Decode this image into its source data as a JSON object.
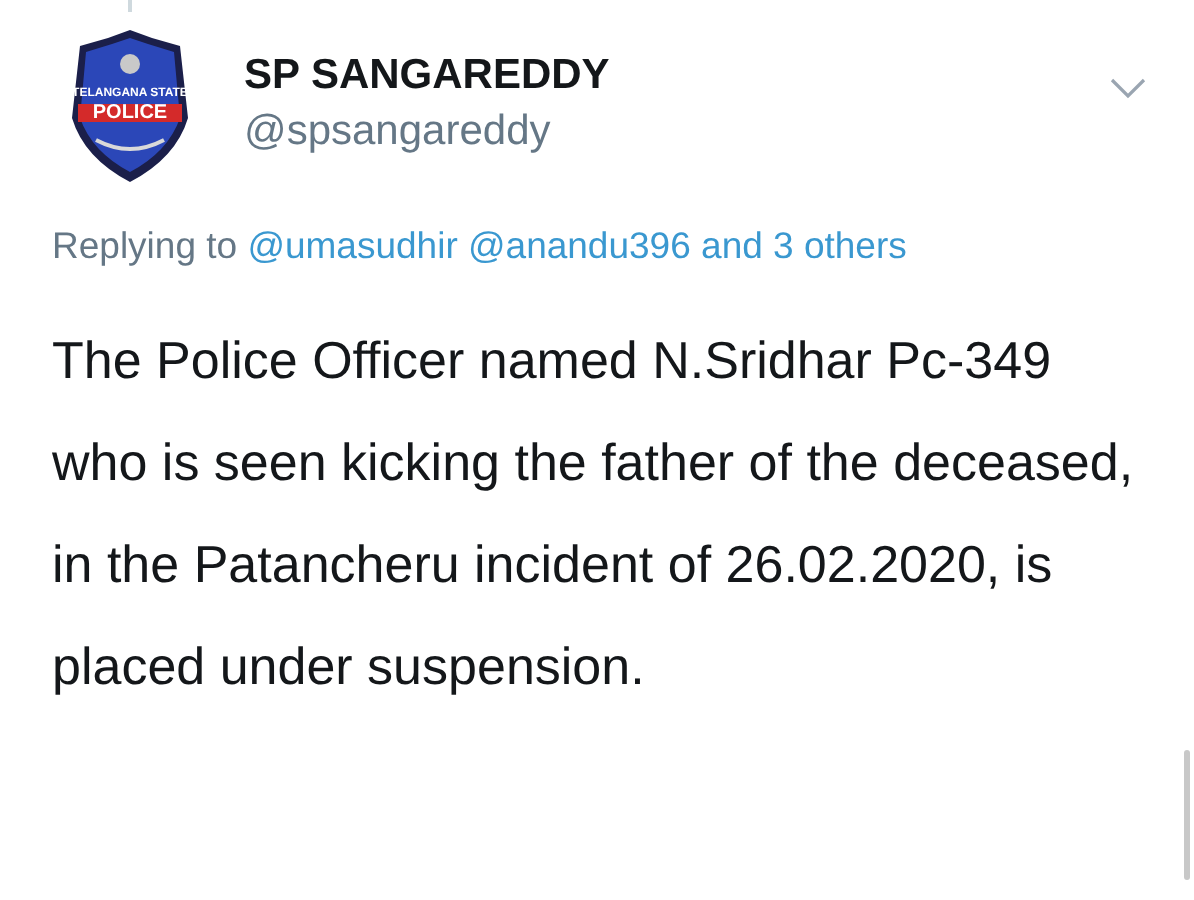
{
  "tweet": {
    "author": {
      "name": "SP SANGAREDDY",
      "handle": "@spsangareddy",
      "avatar": {
        "line_1": "TELANGANA STATE",
        "line_2": "POLICE"
      }
    },
    "reply_to": {
      "prefix": "Replying to",
      "mentions": [
        "@umasudhir",
        "@anandu396"
      ],
      "others": "and 3 others"
    },
    "text": "The Police Officer named N.Sridhar Pc-349 who is seen kicking the father of the deceased, in the Patancheru incident of 26.02.2020, is placed under suspension."
  }
}
